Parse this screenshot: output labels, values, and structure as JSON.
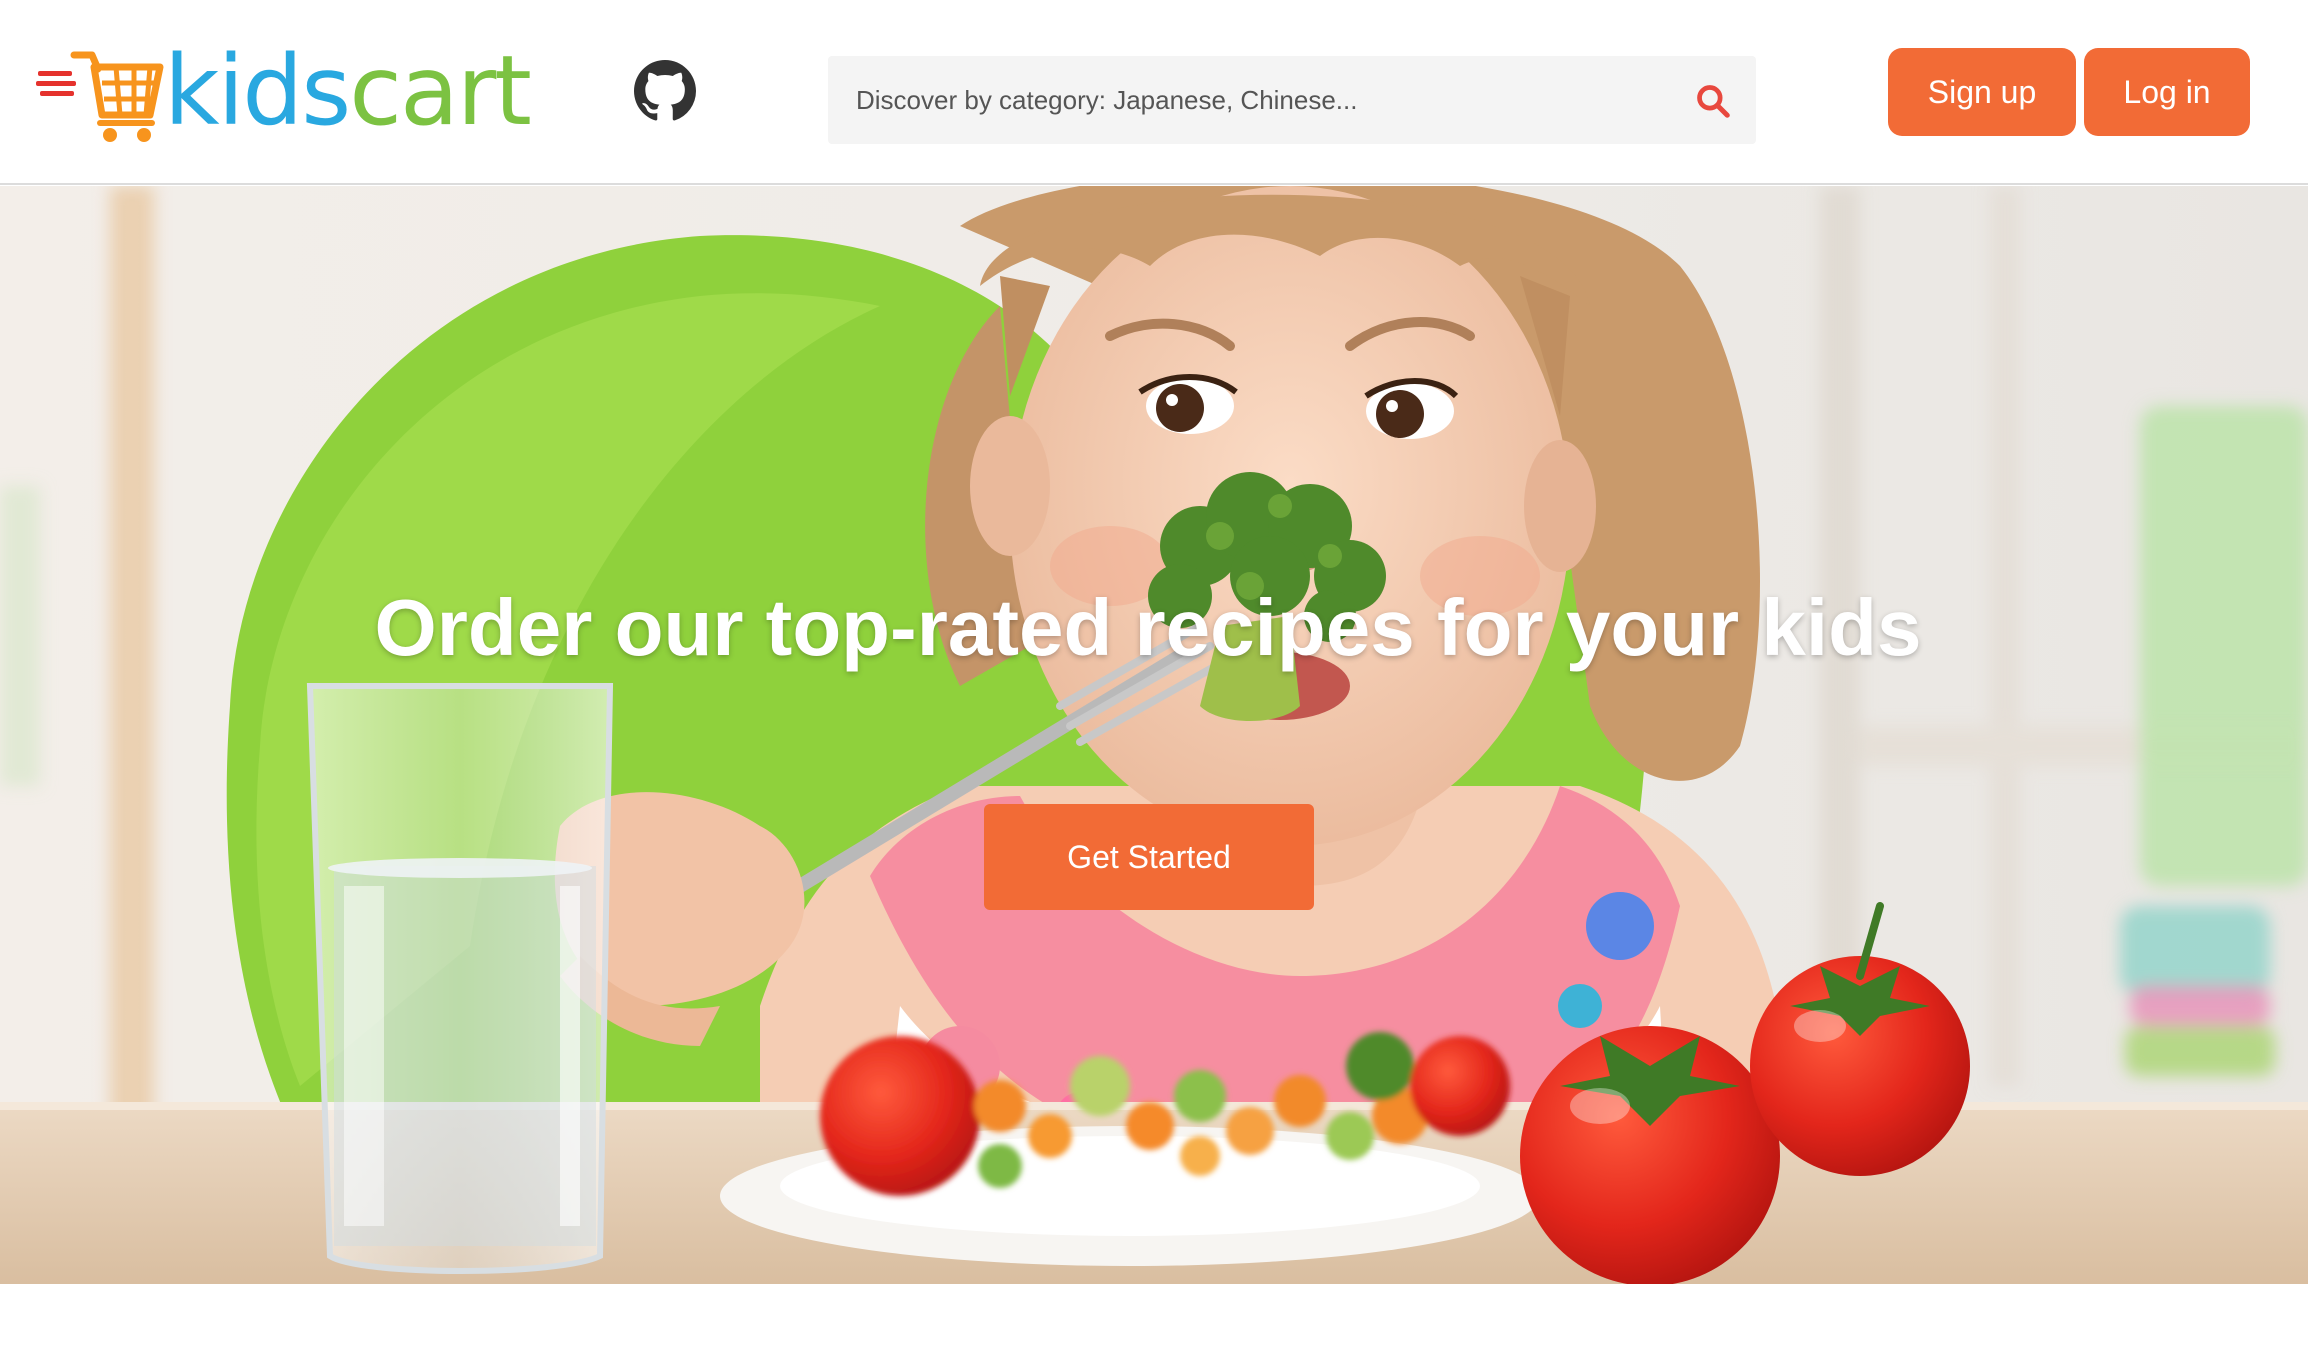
{
  "brand": {
    "name_part1": "kids",
    "name_part2": "cart"
  },
  "header": {
    "search": {
      "placeholder": "Discover by category: Japanese, Chinese..."
    },
    "signup_label": "Sign up",
    "login_label": "Log in"
  },
  "hero": {
    "title": "Order our top-rated recipes for your kids",
    "cta_label": "Get Started"
  },
  "colors": {
    "accent": "#f26b36",
    "logo_blue": "#29a8e0",
    "logo_green": "#7cc242",
    "logo_orange": "#f7941d",
    "logo_red": "#e5322d"
  },
  "icons": {
    "github": "github-icon",
    "search": "search-icon",
    "logo": "shopping-cart-icon"
  }
}
